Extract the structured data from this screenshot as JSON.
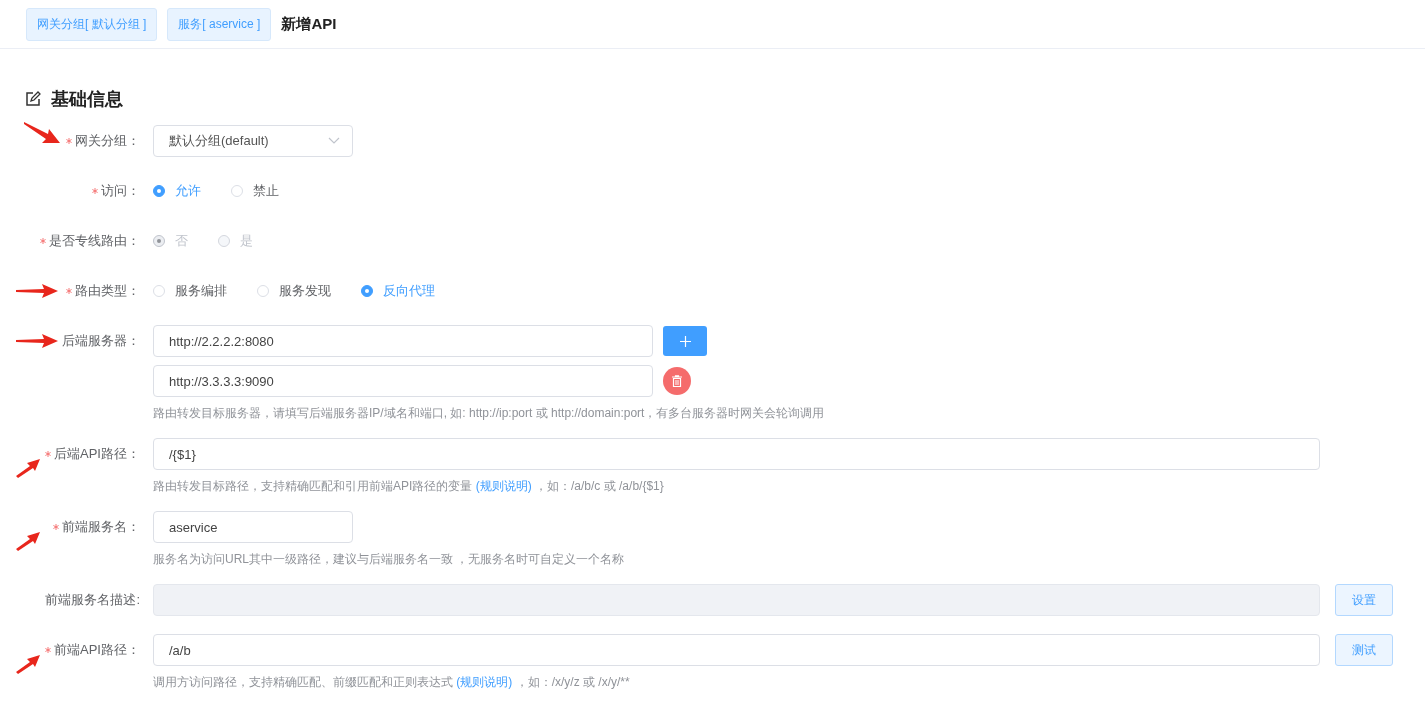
{
  "breadcrumbs": [
    "网关分组[ 默认分组 ]",
    "服务[ aservice ]"
  ],
  "page_title": "新增API",
  "section_title": "基础信息",
  "fields": [
    {
      "kind": "select",
      "label": "网关分组：",
      "required": true,
      "arrow": {
        "kind": "down-right"
      },
      "value": "默认分组(default)"
    },
    {
      "kind": "radio",
      "label": "访问：",
      "required": true,
      "disabled": false,
      "options": [
        {
          "label": "允许",
          "selected": true
        },
        {
          "label": "禁止",
          "selected": false
        }
      ]
    },
    {
      "kind": "radio",
      "label": "是否专线路由：",
      "required": true,
      "disabled": true,
      "options": [
        {
          "label": "否",
          "selected": true
        },
        {
          "label": "是",
          "selected": false
        }
      ]
    },
    {
      "kind": "radio",
      "label": "路由类型：",
      "required": true,
      "arrow": {
        "kind": "right"
      },
      "disabled": false,
      "options": [
        {
          "label": "服务编排",
          "selected": false
        },
        {
          "label": "服务发现",
          "selected": false
        },
        {
          "label": "反向代理",
          "selected": true
        }
      ]
    },
    {
      "kind": "servers",
      "label": "后端服务器：",
      "arrow": {
        "kind": "right"
      },
      "entries": [
        {
          "value": "http://2.2.2.2:8080",
          "kind": "add"
        },
        {
          "value": "http://3.3.3.3:9090",
          "kind": "remove"
        }
      ],
      "hint": {
        "text": "路由转发目标服务器，请填写后端服务器IP/域名和端口, 如: http://ip:port 或 http://domain:port，有多台服务器时网关会轮询调用"
      }
    },
    {
      "kind": "input",
      "label": "后端API路径：",
      "required": true,
      "arrow": {
        "kind": "up-right"
      },
      "value": "/{$1}",
      "hint": {
        "text": "路由转发目标路径，支持精确匹配和引用前端API路径的变量 ",
        "link": "(规则说明)",
        "after": " ，如：/a/b/c 或 /a/b/{$1}"
      }
    },
    {
      "kind": "short-input",
      "label": "前端服务名：",
      "required": true,
      "arrow": {
        "kind": "up-right"
      },
      "value": "aservice",
      "hint": {
        "text": "服务名为访问URL其中一级路径，建议与后端服务名一致 ，无服务名时可自定义一个名称"
      }
    },
    {
      "kind": "input",
      "label": "前端服务名描述:",
      "disabled": true,
      "button": "设置"
    },
    {
      "kind": "input",
      "label": "前端API路径：",
      "required": true,
      "arrow": {
        "kind": "up-right"
      },
      "value": "/a/b",
      "button": "测试",
      "hint": {
        "text": "调用方访问路径，支持精确匹配、前缀匹配和正则表达式 ",
        "link": "(规则说明)",
        "after": " ，如：/x/y/z 或 /x/y/**"
      }
    }
  ]
}
